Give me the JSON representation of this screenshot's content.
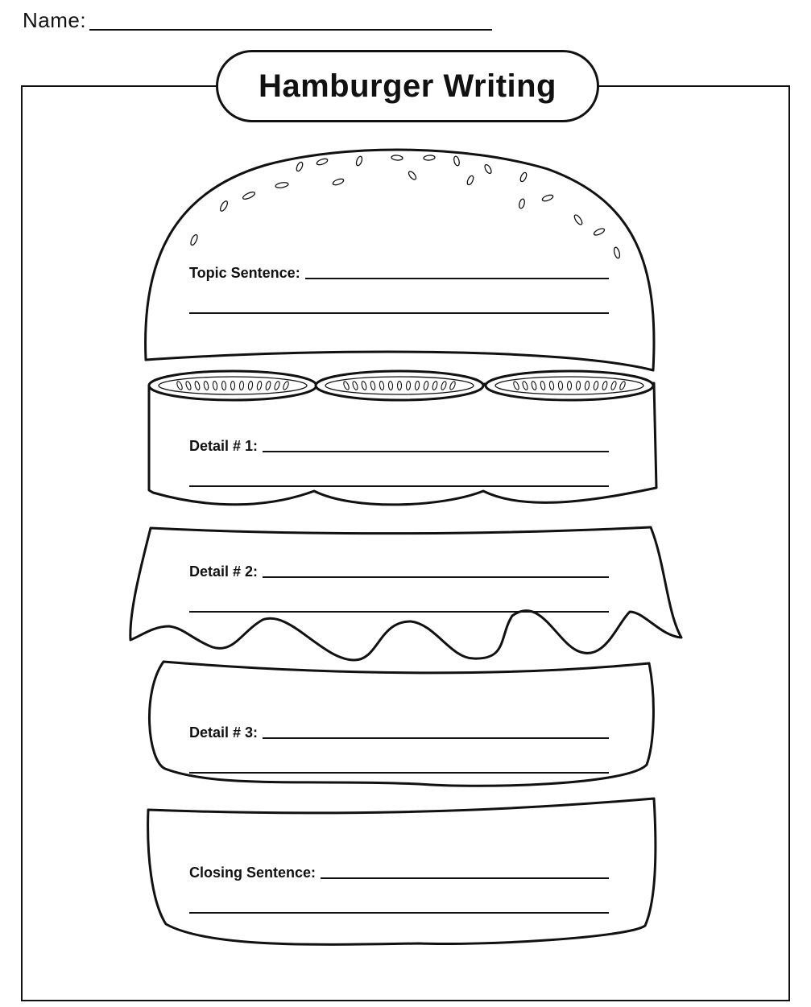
{
  "header": {
    "name_label": "Name:"
  },
  "title": "Hamburger Writing",
  "sections": [
    {
      "label": "Topic Sentence:"
    },
    {
      "label": "Detail # 1:"
    },
    {
      "label": "Detail # 2:"
    },
    {
      "label": "Detail # 3:"
    },
    {
      "label": "Closing Sentence:"
    }
  ]
}
